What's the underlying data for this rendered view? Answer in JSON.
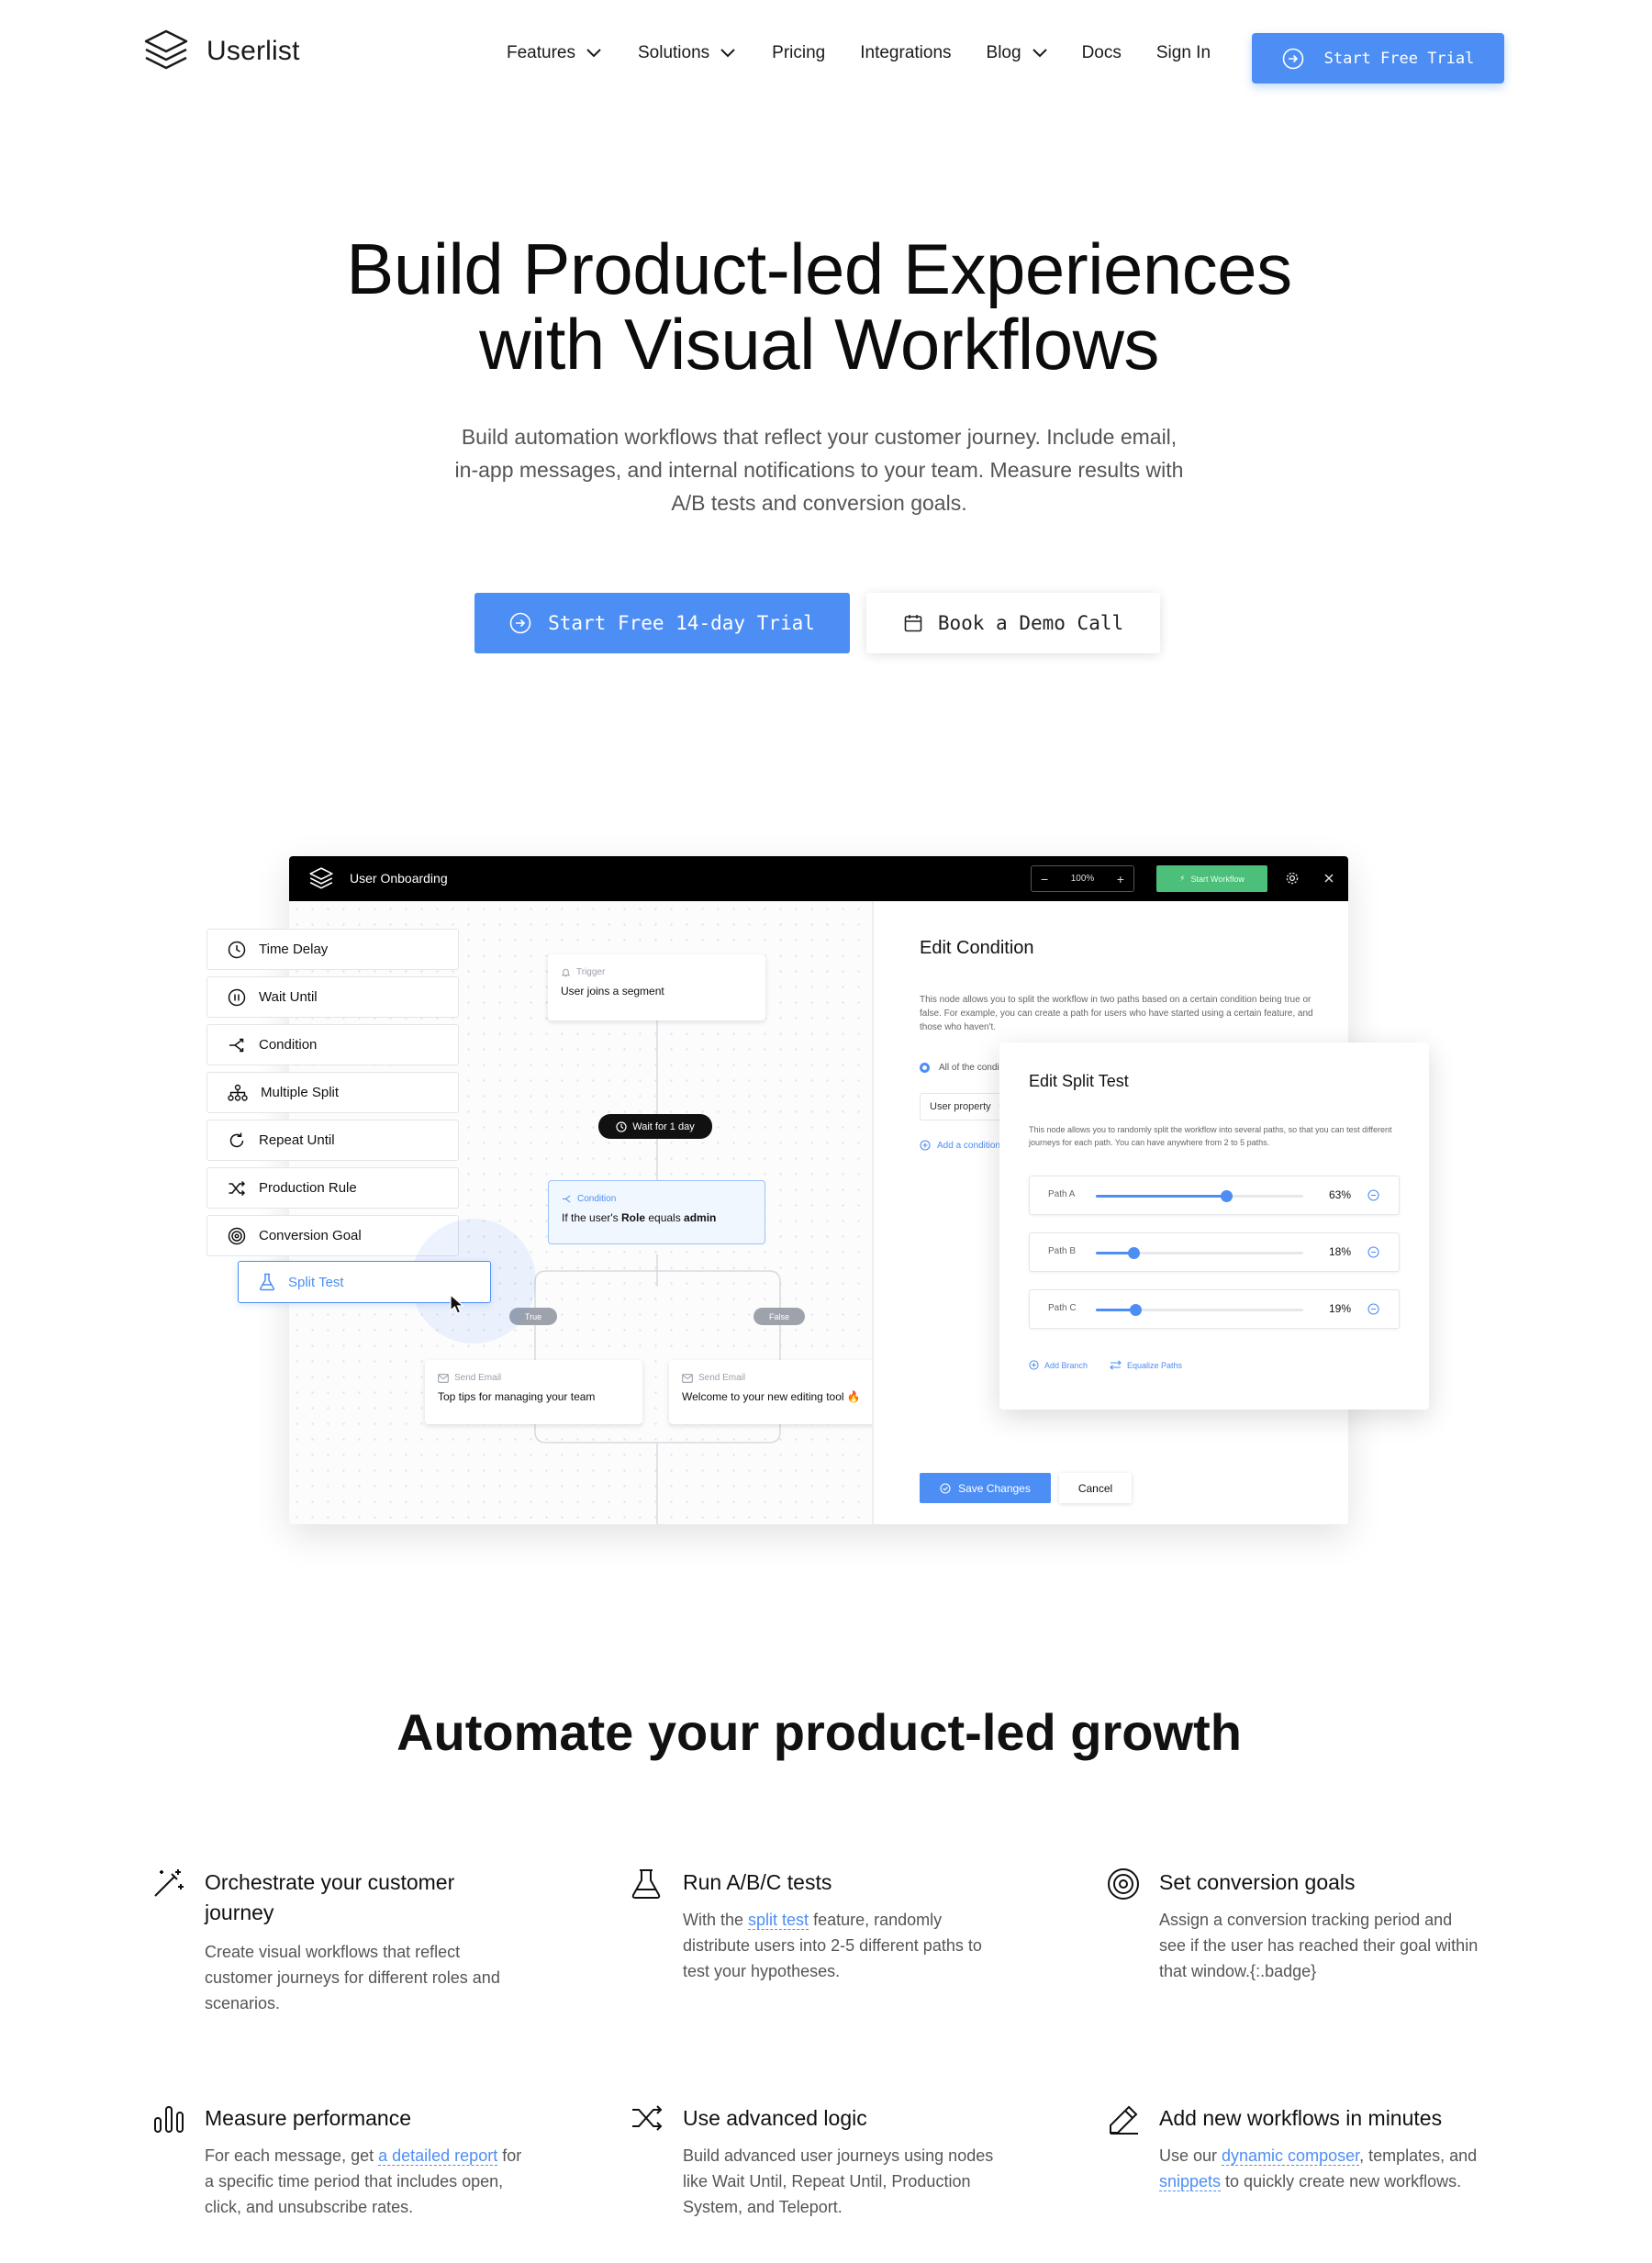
{
  "nav": {
    "logo": "Userlist",
    "items": [
      {
        "label": "Features",
        "dropdown": true
      },
      {
        "label": "Solutions",
        "dropdown": true
      },
      {
        "label": "Pricing",
        "dropdown": false
      },
      {
        "label": "Integrations",
        "dropdown": false
      },
      {
        "label": "Blog",
        "dropdown": true
      },
      {
        "label": "Docs",
        "dropdown": false
      },
      {
        "label": "Sign In",
        "dropdown": false
      }
    ],
    "cta": "Start Free Trial"
  },
  "hero": {
    "title_line1": "Build Product-led Experiences",
    "title_line2": "with Visual Workflows",
    "subtitle_line1": "Build automation workflows that reflect your customer journey. Include email,",
    "subtitle_line2": "in-app messages, and internal notifications to your team. Measure results with",
    "subtitle_line3": "A/B tests and conversion goals.",
    "primary_cta": "Start Free 14-day Trial",
    "secondary_cta": "Book a Demo Call"
  },
  "app": {
    "title": "User Onboarding",
    "zoom": "100%",
    "start_workflow": "Start Workflow",
    "palette": [
      {
        "label": "Time Delay",
        "icon": "clock-icon"
      },
      {
        "label": "Wait Until",
        "icon": "pause-icon"
      },
      {
        "label": "Condition",
        "icon": "branch-icon"
      },
      {
        "label": "Multiple Split",
        "icon": "tree-icon"
      },
      {
        "label": "Repeat Until",
        "icon": "repeat-icon"
      },
      {
        "label": "Production Rule",
        "icon": "shuffle-icon"
      },
      {
        "label": "Conversion Goal",
        "icon": "target-icon"
      }
    ],
    "dragged": "Split Test",
    "trigger_label": "Trigger",
    "trigger_text": "User joins a segment",
    "wait_pill": "Wait for 1 day",
    "condition_label": "Condition",
    "condition_prefix": "If the user's ",
    "condition_role": "Role",
    "condition_mid": " equals ",
    "condition_value": "admin",
    "true_label": "True",
    "false_label": "False",
    "email1_label": "Send Email",
    "email1_text": "Top tips for managing your team",
    "email2_label": "Send Email",
    "email2_text": "Welcome to your new editing tool 🔥",
    "edit_title": "Edit Condition",
    "edit_desc": "This node allows you to split the workflow in two paths based on a certain condition being true or false. For example, you can create a path for users who have started using a certain feature, and those who haven't.",
    "radio_text": "All of the conditi",
    "select_text": "User property",
    "add_condition": "Add a condition",
    "save_changes": "Save Changes",
    "cancel": "Cancel",
    "split_title": "Edit Split Test",
    "split_desc": "This node allows you to randomly split the workflow into several paths, so that you can test different journeys for each path. You can have anywhere from 2 to 5 paths.",
    "paths": [
      {
        "name": "Path A",
        "percent": 63,
        "label": "63%"
      },
      {
        "name": "Path B",
        "percent": 18,
        "label": "18%"
      },
      {
        "name": "Path C",
        "percent": 19,
        "label": "19%"
      }
    ],
    "add_branch": "Add Branch",
    "equalize": "Equalize Paths",
    "colors": {
      "accent": "#4d8ef5",
      "green": "#4cbf7a"
    }
  },
  "section": {
    "title": "Automate your product-led growth",
    "features": [
      {
        "icon": "magic-wand-icon",
        "title": "Orchestrate your customer journey",
        "body": "Create visual workflows that reflect customer journeys for different roles and scenarios."
      },
      {
        "icon": "flask-icon",
        "title": "Run A/B/C tests",
        "body_pre": "With the ",
        "link": "split test",
        "body_post": " feature, randomly distribute users into 2-5 different paths to test your hypotheses."
      },
      {
        "icon": "target-icon",
        "title": "Set conversion goals",
        "body": "Assign a conversion tracking period and see if the user has reached their goal within that window.{:.badge}"
      },
      {
        "icon": "bar-chart-icon",
        "title": "Measure performance",
        "body_pre": "For each message, get ",
        "link": "a detailed report",
        "body_post": " for a specific time period that includes open, click, and unsubscribe rates."
      },
      {
        "icon": "shuffle-icon",
        "title": "Use advanced logic",
        "body": "Build advanced user journeys using nodes like Wait Until, Repeat Until, Production System, and Teleport."
      },
      {
        "icon": "pencil-icon",
        "title": "Add new workflows in minutes",
        "body_pre": "Use our ",
        "link": "dynamic composer",
        "body_mid": ", templates, and ",
        "link2": "snippets",
        "body_post": " to quickly create new workflows."
      }
    ]
  }
}
